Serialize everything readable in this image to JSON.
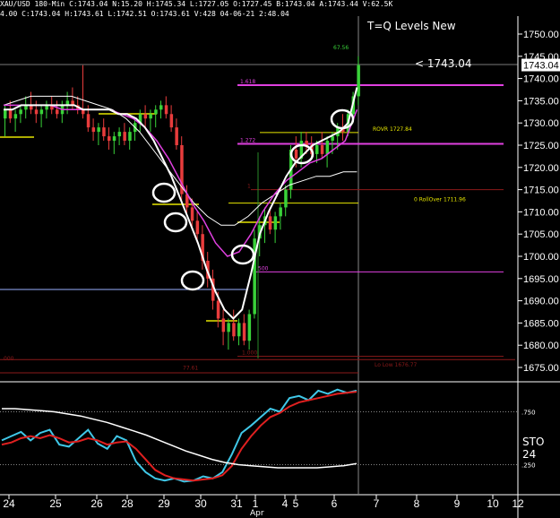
{
  "header": {
    "line1": "XAU/USD  180-Min  C:1743.04  N:15.20  H:1745.34  L:1727.05  O:1727.45  B:1743.04  A:1743.44  V:62.5K",
    "line2": "4.00  C:1743.04  H:1743.61  L:1742.51  O:1743.61  V:428  04-06-21  2:48.04"
  },
  "title": "T=Q Levels New",
  "last_price_label": "< 1743.04",
  "last_price_tag": "1743.04",
  "sto_label": "STO 24",
  "month_label": "Apr",
  "colors": {
    "up": "#39d239",
    "down": "#e83c3c",
    "magenta": "#e040e0",
    "yellow": "#e6e600",
    "blue": "#9ab0ff",
    "darkred": "#8b1a1a",
    "cyan": "#40c8e8",
    "sto_red": "#e02020"
  },
  "chart_data": [
    {
      "type": "candlestick",
      "y_ticks": [
        1675,
        1680,
        1685,
        1690,
        1695,
        1700,
        1705,
        1710,
        1715,
        1720,
        1725,
        1730,
        1735,
        1740,
        1745,
        1750
      ],
      "y_tick_labels": [
        "1675.00",
        "1680.00",
        "1685.00",
        "1690.00",
        "1695.00",
        "1700.00",
        "1705.00",
        "1710.00",
        "1715.00",
        "1720.00",
        "1725.00",
        "1730.00",
        "1735.00",
        "1740.00",
        "1745.00",
        "1750.00"
      ],
      "x_tick_labels": [
        "24",
        "25",
        "26",
        "28",
        "29",
        "30",
        "31",
        "1",
        "4",
        "5",
        "6",
        "7",
        "8",
        "9",
        "10",
        "12"
      ],
      "x_tick_positions": [
        10,
        62,
        108,
        142,
        183,
        224,
        264,
        285,
        318,
        330,
        373,
        420,
        465,
        510,
        550,
        578
      ],
      "levels": [
        {
          "name": "1.618",
          "value": 1738.5,
          "color": "magenta"
        },
        {
          "name": "ROVR 1727.84",
          "value": 1727.84,
          "color": "yellow"
        },
        {
          "name": "1.272",
          "value": 1725.3,
          "color": "magenta"
        },
        {
          "name": "0 RollOver 1711.96",
          "value": 1711.96,
          "color": "yellow"
        },
        {
          "name": "1",
          "value": 1715.0,
          "color": "darkred"
        },
        {
          "name": "500",
          "value": 1696.5,
          "color": "magenta"
        },
        {
          "name": "1.000",
          "value": 1677.5,
          "color": "darkred"
        },
        {
          "name": "Lo Low 1676.77",
          "value": 1676.77,
          "color": "darkred"
        },
        {
          "name": "000",
          "value": 1677.0,
          "color": "darkred"
        },
        {
          "name": "67.56",
          "value": 1747.0,
          "color": "up"
        },
        {
          "name": "77.61",
          "value": 1676.5,
          "color": "darkred"
        }
      ],
      "candles": [
        [
          1731,
          1734,
          1727,
          1733
        ],
        [
          1733,
          1735,
          1730,
          1731
        ],
        [
          1731,
          1733,
          1728,
          1732
        ],
        [
          1732,
          1734,
          1730,
          1733
        ],
        [
          1733,
          1736,
          1731,
          1734
        ],
        [
          1734,
          1737,
          1732,
          1733
        ],
        [
          1733,
          1735,
          1730,
          1732
        ],
        [
          1732,
          1734,
          1729,
          1733
        ],
        [
          1733,
          1735,
          1731,
          1734
        ],
        [
          1734,
          1736,
          1732,
          1733
        ],
        [
          1733,
          1735,
          1731,
          1732
        ],
        [
          1732,
          1735,
          1730,
          1734
        ],
        [
          1734,
          1737,
          1732,
          1735
        ],
        [
          1735,
          1738,
          1733,
          1734
        ],
        [
          1734,
          1736,
          1732,
          1733
        ],
        [
          1733,
          1743,
          1731,
          1732
        ],
        [
          1732,
          1734,
          1728,
          1729
        ],
        [
          1729,
          1731,
          1726,
          1728
        ],
        [
          1728,
          1730,
          1725,
          1729
        ],
        [
          1729,
          1731,
          1726,
          1727
        ],
        [
          1727,
          1729,
          1724,
          1726
        ],
        [
          1726,
          1728,
          1723,
          1727
        ],
        [
          1727,
          1729,
          1725,
          1728
        ],
        [
          1728,
          1730,
          1725,
          1726
        ],
        [
          1726,
          1729,
          1724,
          1728
        ],
        [
          1728,
          1731,
          1726,
          1730
        ],
        [
          1730,
          1733,
          1728,
          1732
        ],
        [
          1732,
          1734,
          1729,
          1731
        ],
        [
          1731,
          1733,
          1728,
          1732
        ],
        [
          1732,
          1734,
          1729,
          1733
        ],
        [
          1733,
          1735,
          1731,
          1734
        ],
        [
          1734,
          1736,
          1731,
          1732
        ],
        [
          1732,
          1734,
          1728,
          1729
        ],
        [
          1729,
          1731,
          1724,
          1725
        ],
        [
          1725,
          1727,
          1712,
          1714
        ],
        [
          1714,
          1716,
          1709,
          1711
        ],
        [
          1711,
          1713,
          1706,
          1708
        ],
        [
          1708,
          1710,
          1703,
          1705
        ],
        [
          1705,
          1707,
          1697,
          1699
        ],
        [
          1699,
          1701,
          1693,
          1695
        ],
        [
          1695,
          1697,
          1688,
          1690
        ],
        [
          1690,
          1692,
          1684,
          1686
        ],
        [
          1686,
          1688,
          1680,
          1683
        ],
        [
          1683,
          1686,
          1679,
          1685
        ],
        [
          1685,
          1688,
          1681,
          1682
        ],
        [
          1682,
          1686,
          1680,
          1685
        ],
        [
          1685,
          1687,
          1680,
          1681
        ],
        [
          1681,
          1688,
          1679,
          1687
        ],
        [
          1687,
          1706,
          1686,
          1704
        ],
        [
          1704,
          1709,
          1700,
          1707
        ],
        [
          1707,
          1711,
          1703,
          1709
        ],
        [
          1709,
          1711,
          1705,
          1706
        ],
        [
          1706,
          1710,
          1703,
          1709
        ],
        [
          1709,
          1712,
          1706,
          1711
        ],
        [
          1711,
          1716,
          1709,
          1715
        ],
        [
          1715,
          1725,
          1713,
          1724
        ],
        [
          1724,
          1727,
          1720,
          1722
        ],
        [
          1722,
          1728,
          1720,
          1726
        ],
        [
          1726,
          1728,
          1723,
          1725
        ],
        [
          1725,
          1727,
          1722,
          1723
        ],
        [
          1723,
          1726,
          1721,
          1725
        ],
        [
          1725,
          1728,
          1722,
          1723
        ],
        [
          1723,
          1727,
          1720,
          1726
        ],
        [
          1726,
          1728,
          1723,
          1727
        ],
        [
          1727,
          1730,
          1724,
          1729
        ],
        [
          1729,
          1732,
          1726,
          1728
        ],
        [
          1728,
          1733,
          1727,
          1732
        ],
        [
          1732,
          1737,
          1730,
          1736
        ],
        [
          1736,
          1745,
          1734,
          1743
        ]
      ],
      "ma_white_fast": [
        1733,
        1733,
        1734,
        1734,
        1734,
        1734,
        1734,
        1734,
        1734,
        1733,
        1733,
        1733,
        1733,
        1732,
        1732,
        1731,
        1729,
        1726,
        1722,
        1718,
        1713,
        1708,
        1703,
        1697,
        1692,
        1688,
        1686,
        1688,
        1696,
        1705,
        1710,
        1714,
        1718,
        1721,
        1723,
        1725,
        1726,
        1727,
        1728,
        1730,
        1738
      ],
      "ma_magenta": [
        1734,
        1734,
        1734,
        1734,
        1734,
        1733,
        1733,
        1733,
        1733,
        1733,
        1732,
        1731,
        1729,
        1726,
        1722,
        1717,
        1712,
        1708,
        1703,
        1700,
        1701,
        1705,
        1710,
        1714,
        1717,
        1719,
        1721,
        1722,
        1724,
        1726,
        1733
      ],
      "ma_white_slow": [
        1734,
        1735,
        1736,
        1736,
        1736,
        1736,
        1735,
        1734,
        1733,
        1731,
        1728,
        1724,
        1720,
        1716,
        1712,
        1709,
        1707,
        1707,
        1709,
        1712,
        1714,
        1716,
        1717,
        1718,
        1718,
        1719,
        1719
      ]
    },
    {
      "type": "line",
      "name": "STO",
      "ylim": [
        0,
        100
      ],
      "y_tick_labels": [
        ".250",
        ".750"
      ],
      "series": [
        {
          "name": "",
          "color": "cyan",
          "values": [
            48,
            52,
            56,
            48,
            55,
            58,
            44,
            42,
            50,
            58,
            45,
            40,
            52,
            48,
            28,
            18,
            12,
            10,
            12,
            9,
            10,
            14,
            12,
            18,
            35,
            55,
            62,
            70,
            78,
            75,
            88,
            90,
            86,
            95,
            92,
            96,
            93,
            95
          ]
        },
        {
          "name": "",
          "color": "sto_red",
          "values": [
            44,
            46,
            50,
            52,
            50,
            53,
            50,
            46,
            47,
            50,
            48,
            44,
            46,
            47,
            40,
            30,
            20,
            15,
            12,
            11,
            10,
            11,
            12,
            15,
            24,
            40,
            52,
            62,
            70,
            74,
            80,
            84,
            86,
            88,
            90,
            92,
            93,
            94
          ]
        },
        {
          "name": "",
          "color": "white",
          "values": [
            78,
            78,
            77,
            76,
            75,
            73,
            71,
            68,
            65,
            61,
            57,
            53,
            48,
            43,
            38,
            34,
            30,
            27,
            25,
            24,
            23,
            22,
            22,
            22,
            22,
            23,
            24,
            26
          ]
        }
      ]
    }
  ]
}
